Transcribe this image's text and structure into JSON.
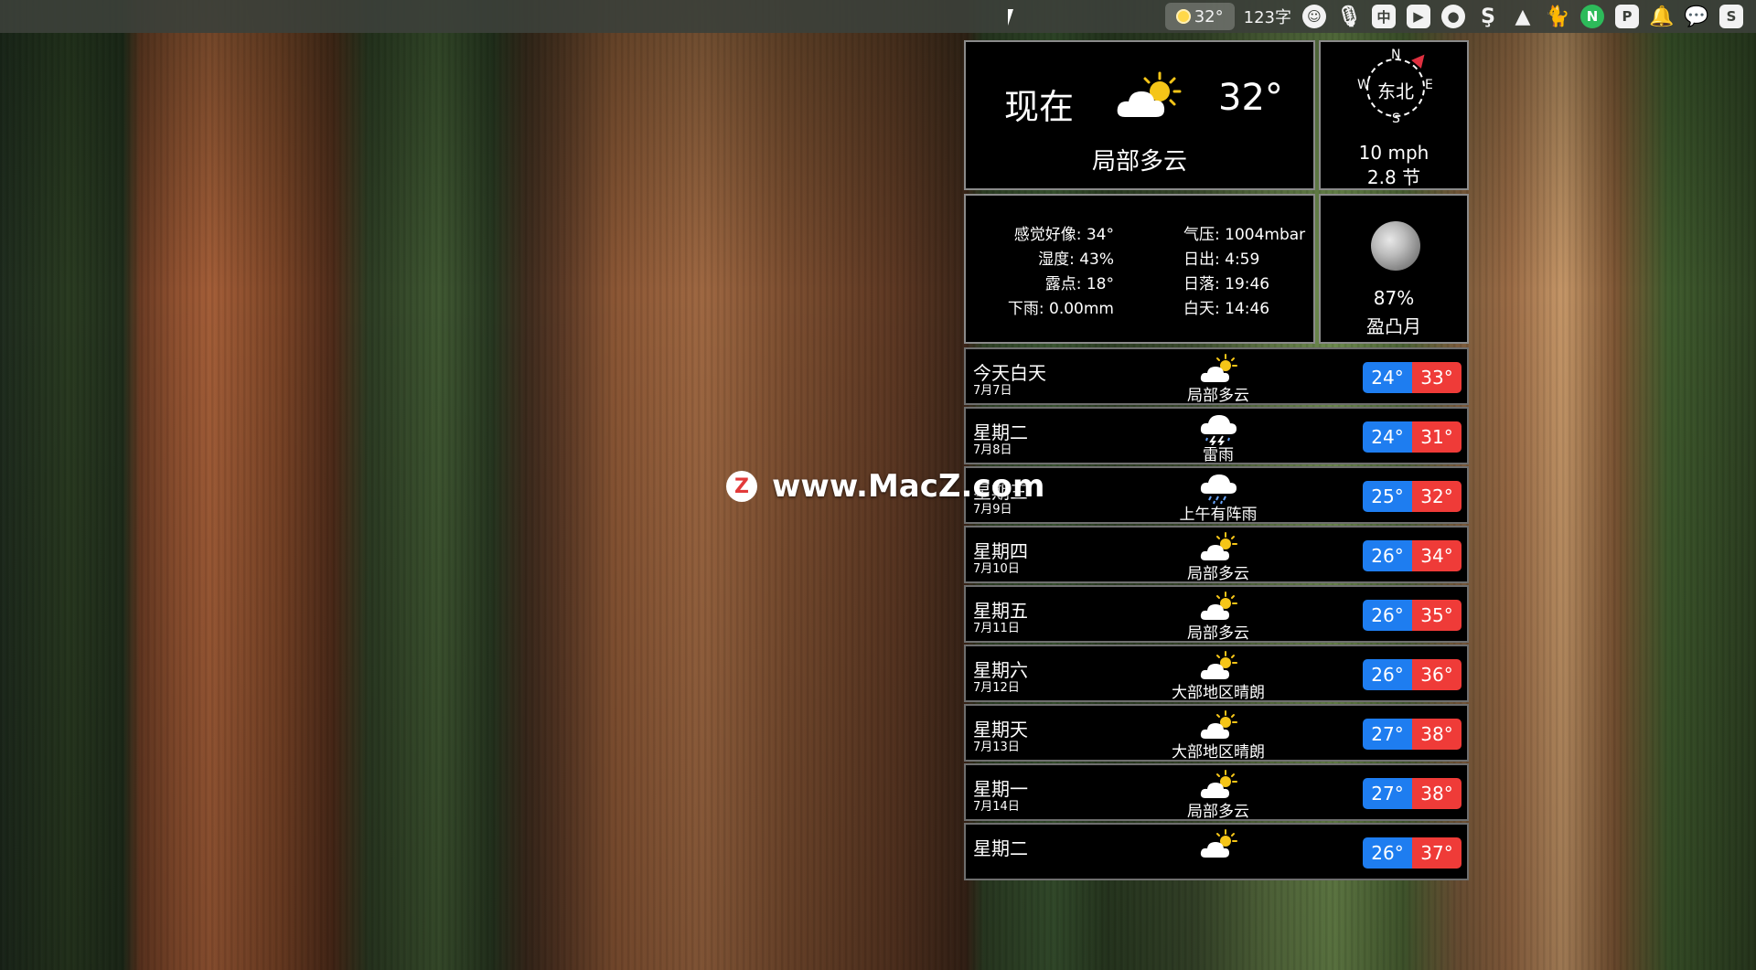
{
  "menubar": {
    "weather_temp": "32°",
    "input_method": "123字",
    "items": [
      "emoji-icon",
      "microphone-icon",
      "chinese-input-icon",
      "bookmark-icon",
      "record-icon",
      "s-icon",
      "mountain-icon",
      "cat-icon",
      "n-icon",
      "p-icon",
      "bell-icon",
      "wechat-icon",
      "s-square-icon"
    ],
    "n_letter": "N",
    "cn_label": "中"
  },
  "now": {
    "label": "现在",
    "temp": "32°",
    "condition": "局部多云",
    "icon": "partly-cloudy-icon"
  },
  "wind": {
    "n": "N",
    "s": "S",
    "e": "E",
    "w": "W",
    "direction": "东北",
    "mph": "10 mph",
    "knots": "2.8 节"
  },
  "stats": {
    "feels_like": "感觉好像: 34°",
    "humidity": "湿度: 43%",
    "dew_point": "露点: 18°",
    "rain": "下雨: 0.00mm",
    "pressure": "气压: 1004mbar",
    "sunrise": "日出: 4:59",
    "sunset": "日落: 19:46",
    "daylight": "白天: 14:46"
  },
  "moon": {
    "percent": "87%",
    "phase": "盈凸月"
  },
  "forecast": [
    {
      "day": "今天白天",
      "date": "7月7日",
      "cond": "局部多云",
      "low": "24°",
      "high": "33°",
      "icon": "partly-cloudy"
    },
    {
      "day": "星期二",
      "date": "7月8日",
      "cond": "雷雨",
      "low": "24°",
      "high": "31°",
      "icon": "thunderstorm"
    },
    {
      "day": "星期三",
      "date": "7月9日",
      "cond": "上午有阵雨",
      "low": "25°",
      "high": "32°",
      "icon": "showers"
    },
    {
      "day": "星期四",
      "date": "7月10日",
      "cond": "局部多云",
      "low": "26°",
      "high": "34°",
      "icon": "partly-cloudy"
    },
    {
      "day": "星期五",
      "date": "7月11日",
      "cond": "局部多云",
      "low": "26°",
      "high": "35°",
      "icon": "partly-cloudy"
    },
    {
      "day": "星期六",
      "date": "7月12日",
      "cond": "大部地区晴朗",
      "low": "26°",
      "high": "36°",
      "icon": "mostly-sunny"
    },
    {
      "day": "星期天",
      "date": "7月13日",
      "cond": "大部地区晴朗",
      "low": "27°",
      "high": "38°",
      "icon": "mostly-sunny"
    },
    {
      "day": "星期一",
      "date": "7月14日",
      "cond": "局部多云",
      "low": "27°",
      "high": "38°",
      "icon": "partly-cloudy"
    },
    {
      "day": "星期二",
      "date": "",
      "cond": "",
      "low": "26°",
      "high": "37°",
      "icon": "partly-cloudy"
    }
  ],
  "watermark": {
    "logo": "Z",
    "text": "www.MacZ.com"
  }
}
